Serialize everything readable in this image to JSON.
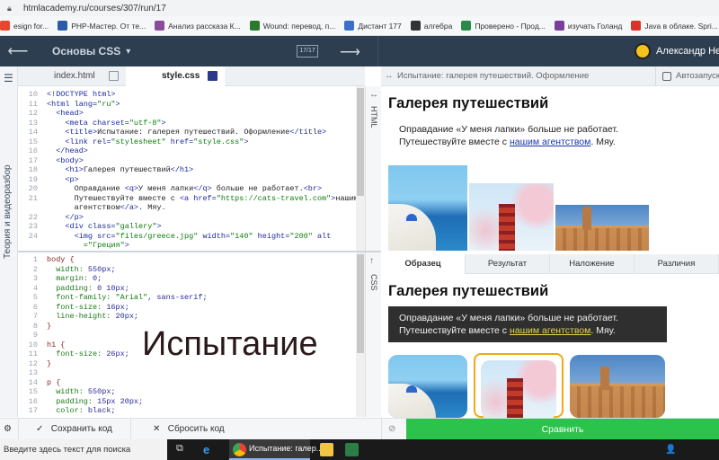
{
  "browser": {
    "url": "htmlacademy.ru/courses/307/run/17",
    "bookmarks": [
      {
        "label": "esign for...",
        "color": "#e9462f"
      },
      {
        "label": "PHP-Мастер. От те...",
        "color": "#2a5aa8"
      },
      {
        "label": "Анализ рассказа К...",
        "color": "#8b4c9c"
      },
      {
        "label": "Wound: перевод, п...",
        "color": "#2b7a2b"
      },
      {
        "label": "Дистант 177",
        "color": "#3b6fc8"
      },
      {
        "label": "алгебра",
        "color": "#333333"
      },
      {
        "label": "Проверено - Прод...",
        "color": "#2a8a4a"
      },
      {
        "label": "изучать Голанд",
        "color": "#7a3f9d"
      },
      {
        "label": "Java в облаке. Spri...",
        "color": "#d9342b"
      },
      {
        "label": "#000000",
        "color": "#ea4335"
      }
    ]
  },
  "header": {
    "course_title": "Основы CSS",
    "counter": "17/17",
    "user_name": "Александр Несте"
  },
  "sidebar": {
    "vertical_label": "Теория и видеоразбор"
  },
  "editor": {
    "tabs": [
      {
        "label": "index.html",
        "active": false
      },
      {
        "label": "style.css",
        "active": true
      }
    ],
    "html_side_label": "HTML",
    "css_side_label": "CSS",
    "html_lines": [
      {
        "n": "10",
        "parts": [
          {
            "c": "tag",
            "t": "<!DOCTYPE html>"
          }
        ]
      },
      {
        "n": "11",
        "parts": [
          {
            "c": "tag",
            "t": "<html "
          },
          {
            "c": "attr",
            "t": "lang="
          },
          {
            "c": "str",
            "t": "\"ru\""
          },
          {
            "c": "tag",
            "t": ">"
          }
        ]
      },
      {
        "n": "12",
        "parts": [
          {
            "c": "tag",
            "t": "  <head>"
          }
        ]
      },
      {
        "n": "13",
        "parts": [
          {
            "c": "tag",
            "t": "    <meta "
          },
          {
            "c": "attr",
            "t": "charset="
          },
          {
            "c": "str",
            "t": "\"utf-8\""
          },
          {
            "c": "tag",
            "t": ">"
          }
        ]
      },
      {
        "n": "14",
        "parts": [
          {
            "c": "tag",
            "t": "    <title>"
          },
          {
            "c": "txt",
            "t": "Испытание: галерея путешествий. Оформление"
          },
          {
            "c": "tag",
            "t": "</title>"
          }
        ]
      },
      {
        "n": "15",
        "parts": [
          {
            "c": "tag",
            "t": "    <link "
          },
          {
            "c": "attr",
            "t": "rel="
          },
          {
            "c": "str",
            "t": "\"stylesheet\""
          },
          {
            "c": "attr",
            "t": " href="
          },
          {
            "c": "str",
            "t": "\"style.css\""
          },
          {
            "c": "tag",
            "t": ">"
          }
        ]
      },
      {
        "n": "16",
        "parts": [
          {
            "c": "tag",
            "t": "  </head>"
          }
        ]
      },
      {
        "n": "17",
        "parts": [
          {
            "c": "tag",
            "t": "  <body>"
          }
        ]
      },
      {
        "n": "18",
        "parts": [
          {
            "c": "tag",
            "t": "    <h1>"
          },
          {
            "c": "txt",
            "t": "Галерея путешествий"
          },
          {
            "c": "tag",
            "t": "</h1>"
          }
        ]
      },
      {
        "n": "19",
        "parts": [
          {
            "c": "tag",
            "t": "    <p>"
          }
        ]
      },
      {
        "n": "20",
        "parts": [
          {
            "c": "txt",
            "t": "      Оправдание "
          },
          {
            "c": "tag",
            "t": "<q>"
          },
          {
            "c": "txt",
            "t": "У меня лапки"
          },
          {
            "c": "tag",
            "t": "</q>"
          },
          {
            "c": "txt",
            "t": " больше не работает."
          },
          {
            "c": "tag",
            "t": "<br>"
          }
        ]
      },
      {
        "n": "21",
        "parts": [
          {
            "c": "txt",
            "t": "      Путешествуйте вместе с "
          },
          {
            "c": "tag",
            "t": "<a "
          },
          {
            "c": "attr",
            "t": "href="
          },
          {
            "c": "str",
            "t": "\"https://cats-travel.com\""
          },
          {
            "c": "tag",
            "t": ">"
          },
          {
            "c": "txt",
            "t": "нашим"
          }
        ]
      },
      {
        "n": "",
        "parts": [
          {
            "c": "txt",
            "t": "      агентством"
          },
          {
            "c": "tag",
            "t": "</a>"
          },
          {
            "c": "txt",
            "t": ". Мяу."
          }
        ]
      },
      {
        "n": "22",
        "parts": [
          {
            "c": "tag",
            "t": "    </p>"
          }
        ]
      },
      {
        "n": "23",
        "parts": [
          {
            "c": "tag",
            "t": "    <div "
          },
          {
            "c": "attr",
            "t": "class="
          },
          {
            "c": "str",
            "t": "\"gallery\""
          },
          {
            "c": "tag",
            "t": ">"
          }
        ]
      },
      {
        "n": "24",
        "parts": [
          {
            "c": "tag",
            "t": "      <img "
          },
          {
            "c": "attr",
            "t": "src="
          },
          {
            "c": "str",
            "t": "\"files/greece.jpg\""
          },
          {
            "c": "attr",
            "t": " width="
          },
          {
            "c": "str",
            "t": "\"140\""
          },
          {
            "c": "attr",
            "t": " height="
          },
          {
            "c": "str",
            "t": "\"200\""
          },
          {
            "c": "attr",
            "t": " alt"
          }
        ]
      },
      {
        "n": "",
        "parts": [
          {
            "c": "str",
            "t": "        =\"Греция\""
          },
          {
            "c": "tag",
            "t": ">"
          }
        ]
      }
    ],
    "css_lines": [
      {
        "n": "1",
        "parts": [
          {
            "c": "sel",
            "t": "body {"
          }
        ]
      },
      {
        "n": "2",
        "parts": [
          {
            "c": "prop",
            "t": "  width: "
          },
          {
            "c": "val",
            "t": "550px;"
          }
        ]
      },
      {
        "n": "3",
        "parts": [
          {
            "c": "prop",
            "t": "  margin: "
          },
          {
            "c": "val",
            "t": "0;"
          }
        ]
      },
      {
        "n": "4",
        "parts": [
          {
            "c": "prop",
            "t": "  padding: "
          },
          {
            "c": "val",
            "t": "0 10px;"
          }
        ]
      },
      {
        "n": "5",
        "parts": [
          {
            "c": "prop",
            "t": "  font-family: "
          },
          {
            "c": "str",
            "t": "\"Arial\""
          },
          {
            "c": "val",
            "t": ", sans-serif;"
          }
        ]
      },
      {
        "n": "6",
        "parts": [
          {
            "c": "prop",
            "t": "  font-size: "
          },
          {
            "c": "val",
            "t": "16px;"
          }
        ]
      },
      {
        "n": "7",
        "parts": [
          {
            "c": "prop",
            "t": "  line-height: "
          },
          {
            "c": "val",
            "t": "20px;"
          }
        ]
      },
      {
        "n": "8",
        "parts": [
          {
            "c": "sel",
            "t": "}"
          }
        ]
      },
      {
        "n": "9",
        "parts": [
          {
            "c": "txt",
            "t": ""
          }
        ]
      },
      {
        "n": "10",
        "parts": [
          {
            "c": "sel",
            "t": "h1 {"
          }
        ]
      },
      {
        "n": "11",
        "parts": [
          {
            "c": "prop",
            "t": "  font-size: "
          },
          {
            "c": "val",
            "t": "26px;"
          }
        ]
      },
      {
        "n": "12",
        "parts": [
          {
            "c": "sel",
            "t": "}"
          }
        ]
      },
      {
        "n": "13",
        "parts": [
          {
            "c": "txt",
            "t": ""
          }
        ]
      },
      {
        "n": "14",
        "parts": [
          {
            "c": "sel",
            "t": "p {"
          }
        ]
      },
      {
        "n": "15",
        "parts": [
          {
            "c": "prop",
            "t": "  width: "
          },
          {
            "c": "val",
            "t": "550px;"
          }
        ]
      },
      {
        "n": "16",
        "parts": [
          {
            "c": "prop",
            "t": "  padding: "
          },
          {
            "c": "val",
            "t": "15px 20px;"
          }
        ]
      },
      {
        "n": "17",
        "parts": [
          {
            "c": "prop",
            "t": "  color: "
          },
          {
            "c": "val",
            "t": "black;"
          }
        ]
      },
      {
        "n": "18",
        "parts": [
          {
            "c": "sel",
            "t": "}"
          }
        ]
      }
    ],
    "overlay_title": "Испытание"
  },
  "preview": {
    "header_title": "Испытание: галерея путешествий. Оформление",
    "autorun_label": "Автозапуск",
    "heading": "Галерея путешествий",
    "line1": "Оправдание «У меня лапки» больше не работает.",
    "line2_before": "Путешествуйте вместе с ",
    "link_text": "нашим агентством",
    "line2_after": ". Мяу.",
    "tabs": [
      "Образец",
      "Результат",
      "Наложение",
      "Различия"
    ]
  },
  "actions": {
    "save_label": "Сохранить код",
    "reset_label": "Сбросить код",
    "compare_label": "Сравнить"
  },
  "taskbar": {
    "search_placeholder": "Введите здесь текст для поиска",
    "active_app": "Испытание: галер..."
  }
}
